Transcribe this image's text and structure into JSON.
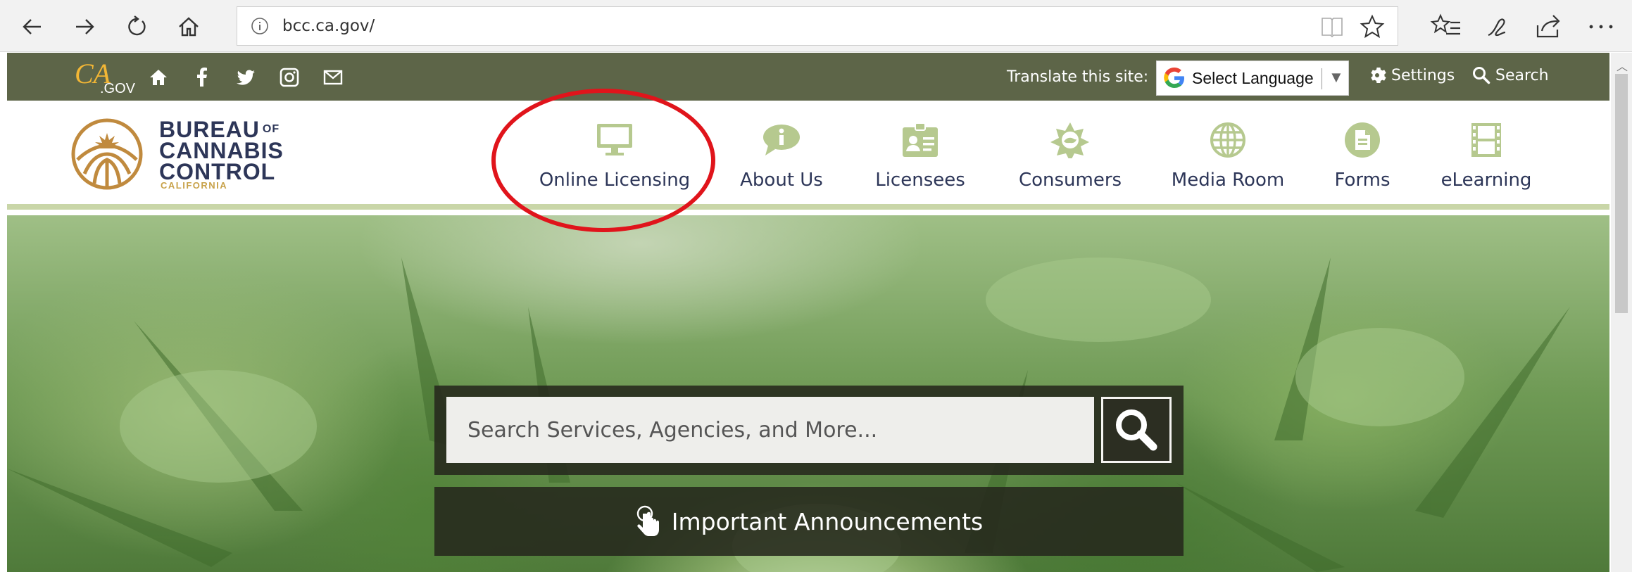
{
  "browser": {
    "url": "bcc.ca.gov/"
  },
  "utility": {
    "logo_text": "CA.GOV",
    "translate_label": "Translate this site:",
    "language_select": "Select Language",
    "settings_label": "Settings",
    "search_label": "Search"
  },
  "brand": {
    "line1": "BUREAU",
    "of": "OF",
    "line2": "CANNABIS",
    "line3": "CONTROL",
    "sub": "CALIFORNIA"
  },
  "nav": {
    "items": [
      {
        "label": "Online Licensing",
        "icon": "monitor-icon"
      },
      {
        "label": "About Us",
        "icon": "info-bubble-icon"
      },
      {
        "label": "Licensees",
        "icon": "id-badge-icon"
      },
      {
        "label": "Consumers",
        "icon": "consumer-badge-icon"
      },
      {
        "label": "Media Room",
        "icon": "globe-icon"
      },
      {
        "label": "Forms",
        "icon": "document-icon"
      },
      {
        "label": "eLearning",
        "icon": "film-icon"
      }
    ]
  },
  "hero": {
    "search_placeholder": "Search Services, Agencies, and More...",
    "announcements_label": "Important Announcements"
  },
  "colors": {
    "utility_bg": "#5d6548",
    "nav_icon": "#b6c98f",
    "nav_text": "#2d3658",
    "highlight": "#e0141b",
    "accent_gold": "#c8a24a"
  }
}
